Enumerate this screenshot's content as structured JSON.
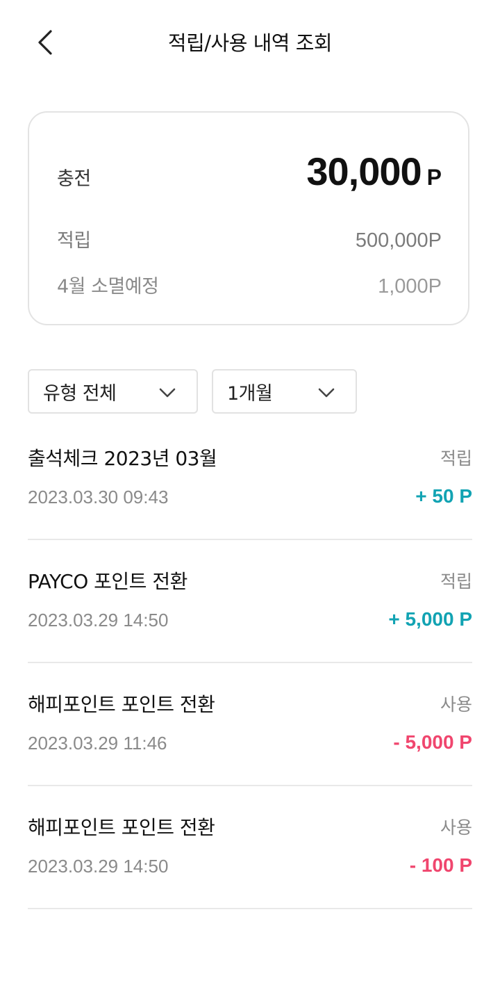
{
  "header": {
    "title": "적립/사용 내역 조회"
  },
  "summary": {
    "charge_label": "충전",
    "charge_value": "30,000",
    "charge_unit": "P",
    "accum_label": "적립",
    "accum_value": "500,000P",
    "expire_label": "4월 소멸예정",
    "expire_value": "1,000P"
  },
  "filters": {
    "type_label": "유형 전체",
    "period_label": "1개월"
  },
  "colors": {
    "earn": "#12a3b3",
    "use": "#f0466e"
  },
  "transactions": [
    {
      "title": "출석체크 2023년 03월",
      "type": "적립",
      "date": "2023.03.30 09:43",
      "amount": "+ 50 P"
    },
    {
      "title": "PAYCO 포인트 전환",
      "type": "적립",
      "date": "2023.03.29 14:50",
      "amount": "+ 5,000 P"
    },
    {
      "title": "해피포인트 포인트 전환",
      "type": "사용",
      "date": "2023.03.29 11:46",
      "amount": "- 5,000 P"
    },
    {
      "title": "해피포인트 포인트 전환",
      "type": "사용",
      "date": "2023.03.29 14:50",
      "amount": "- 100 P"
    }
  ]
}
